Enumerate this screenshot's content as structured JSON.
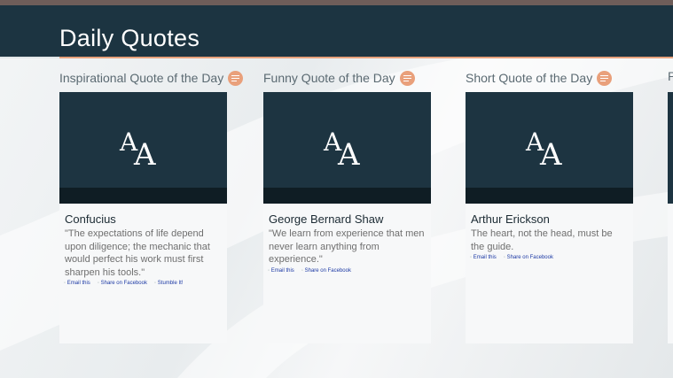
{
  "app": {
    "title": "Daily Quotes"
  },
  "colors": {
    "header": "#1c3441",
    "accent": "#e8a27c",
    "tile": "#1d3441"
  },
  "columns": [
    {
      "header": "Inspirational Quote of the Day",
      "icon": "menu-icon",
      "author": "Confucius",
      "quote": "\"The expectations of life depend upon diligence; the mechanic that would perfect his work must first sharpen his tools.\"",
      "links": [
        "Email this",
        "Share on Facebook",
        "Stumble It!"
      ]
    },
    {
      "header": "Funny Quote of the Day",
      "icon": "menu-icon",
      "author": "George Bernard Shaw",
      "quote": "\"We learn from experience that men never learn anything from experience.\"",
      "links": [
        "Email this",
        "Share on Facebook"
      ]
    },
    {
      "header": "Short Quote of the Day",
      "icon": "menu-icon",
      "author": "Arthur Erickson",
      "quote": "The heart, not the head, must be the guide.",
      "links": [
        "Email this",
        "Share on Facebook"
      ]
    }
  ],
  "partial_column": {
    "header": "P"
  }
}
